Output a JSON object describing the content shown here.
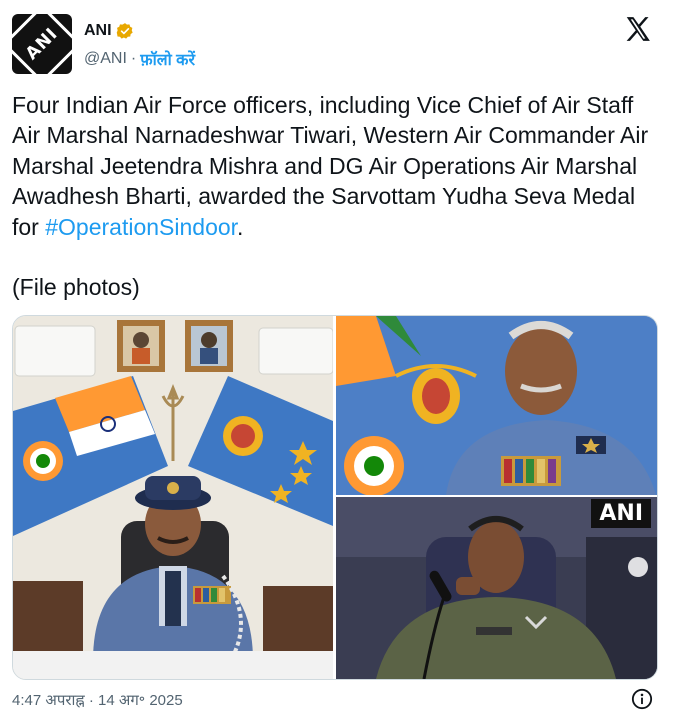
{
  "author": {
    "avatar_text": "ANI",
    "display_name": "ANI",
    "handle": "@ANI",
    "separator": "·",
    "follow_label": "फ़ॉलो करें",
    "verified_color": "#e8a800"
  },
  "tweet": {
    "text_main": "Four Indian Air Force officers, including Vice Chief of Air Staff Air Marshal Narnadeshwar Tiwari, Western Air Commander Air Marshal Jeetendra Mishra and DG Air Operations Air Marshal Awadhesh Bharti, awarded the Sarvottam Yudha Seva Medal for ",
    "hashtag": "#OperationSindoor",
    "text_end": ".",
    "note": "(File photos)"
  },
  "media": {
    "overlay_logo": "ANI"
  },
  "footer": {
    "timestamp": "4:47 अपराह्न · 14 अग॰ 2025"
  },
  "colors": {
    "link": "#1d9bf0",
    "muted": "#536471",
    "iaf_blue": "#4d7fc6"
  },
  "icons": {
    "close": "x-logo-icon",
    "verified": "verified-badge-icon",
    "info": "info-icon"
  }
}
